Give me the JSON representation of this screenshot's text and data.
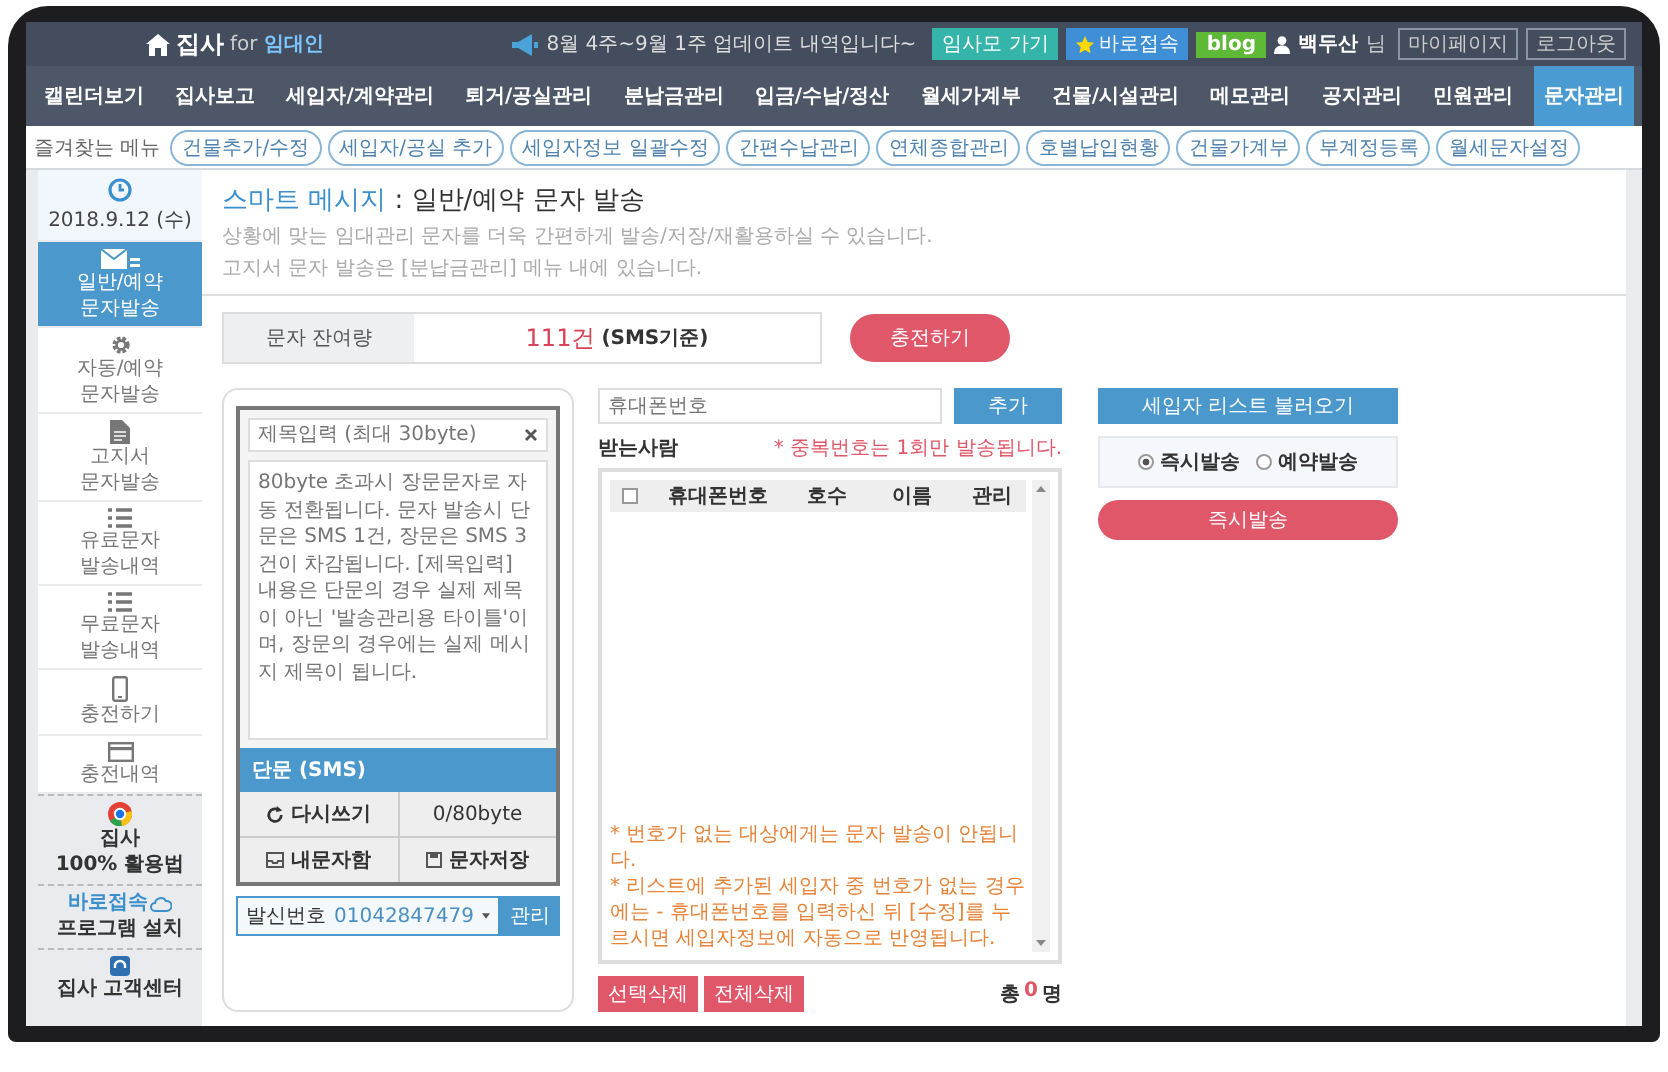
{
  "top_bar": {
    "logo": "집사",
    "logo_for": "for",
    "logo_user": "임대인",
    "notice": "8월 4주~9월 1주 업데이트 내역입니다~",
    "buttons": [
      {
        "label": "임사모 가기",
        "kind": "teal"
      },
      {
        "label": "바로접속",
        "kind": "star"
      },
      {
        "label": "blog",
        "kind": "blog"
      }
    ],
    "user": "백두산",
    "user_suffix": "님",
    "links": [
      "마이페이지",
      "로그아웃"
    ]
  },
  "nav": [
    {
      "label": "캘린더보기",
      "selected": false
    },
    {
      "label": "집사보고",
      "selected": false
    },
    {
      "label": "세입자/계약관리",
      "selected": false
    },
    {
      "label": "퇴거/공실관리",
      "selected": false
    },
    {
      "label": "분납금관리",
      "selected": false
    },
    {
      "label": "입금/수납/정산",
      "selected": false
    },
    {
      "label": "월세가계부",
      "selected": false
    },
    {
      "label": "건물/시설관리",
      "selected": false
    },
    {
      "label": "메모관리",
      "selected": false
    },
    {
      "label": "공지관리",
      "selected": false
    },
    {
      "label": "민원관리",
      "selected": false
    },
    {
      "label": "문자관리",
      "selected": true
    }
  ],
  "quick_menu": {
    "label": "즐겨찾는 메뉴",
    "items": [
      "건물추가/수정",
      "세입자/공실 추가",
      "세입자정보 일괄수정",
      "간편수납관리",
      "연체종합관리",
      "호별납입현황",
      "건물가계부",
      "부계정등록",
      "월세문자설정"
    ]
  },
  "sidebar": {
    "date": "2018.9.12 (수)",
    "items": [
      {
        "lines": [
          "일반/예약",
          "문자발송"
        ],
        "selected": true
      },
      {
        "lines": [
          "자동/예약",
          "문자발송"
        ],
        "selected": false
      },
      {
        "lines": [
          "고지서",
          "문자발송"
        ],
        "selected": false
      },
      {
        "lines": [
          "유료문자",
          "발송내역"
        ],
        "selected": false
      },
      {
        "lines": [
          "무료문자",
          "발송내역"
        ],
        "selected": false
      },
      {
        "lines": [
          "충전하기"
        ],
        "selected": false
      },
      {
        "lines": [
          "충전내역"
        ],
        "selected": false
      }
    ],
    "promos": [
      {
        "lines": [
          "집사",
          "100% 활용법"
        ]
      },
      {
        "lines": [
          "바로접속",
          "프로그램 설치"
        ]
      },
      {
        "lines": [
          "집사 고객센터"
        ]
      }
    ]
  },
  "page": {
    "title_highlight": "스마트 메시지",
    "title_rest": ": 일반/예약 문자 발송",
    "description": [
      "상황에 맞는 임대관리 문자를 더욱 간편하게 발송/저장/재활용하실 수 있습니다.",
      "고지서 문자 발송은 [분납금관리] 메뉴 내에 있습니다."
    ]
  },
  "balance": {
    "label": "문자 잔여량",
    "count": "111건",
    "unit": "(SMS기준)",
    "charge_button": "충전하기"
  },
  "composer": {
    "subject_placeholder": "제목입력 (최대 30byte)",
    "message_placeholder": "80byte 초과시 장문문자로 자동 전환됩니다. 문자 발송시 단문은 SMS 1건, 장문은 SMS 3건이 차감됩니다. [제목입력] 내용은 단문의 경우 실제 제목이 아닌 '발송관리용 타이틀'이며, 장문의 경우에는 실제 메시지 제목이 됩니다.",
    "type_label": "단문 (SMS)",
    "rewrite_button": "다시쓰기",
    "byte_count": "0/80byte",
    "inbox_button": "내문자함",
    "save_button": "문자저장",
    "sender_label": "발신번호",
    "sender_value": "01042847479",
    "manage_button": "관리"
  },
  "recipients": {
    "phone_placeholder": "휴대폰번호",
    "add_button": "추가",
    "title": "받는사람",
    "notice": "* 중복번호는 1회만 발송됩니다.",
    "select_all_checked": false,
    "columns": [
      "휴대폰번호",
      "호수",
      "이름",
      "관리"
    ],
    "notes": [
      "* 번호가 없는 대상에게는 문자 발송이 안됩니다.",
      "* 리스트에 추가된 세입자 중 번호가 없는 경우에는 - 휴대폰번호를 입력하신 뒤 [수정]를 누르시면 세입자정보에 자동으로 반영됩니다."
    ],
    "buttons": [
      "선택삭제",
      "전체삭제"
    ],
    "total_prefix": "총",
    "total": "0",
    "total_suffix": "명"
  },
  "send": {
    "load_button": "세입자 리스트 불러오기",
    "options": [
      {
        "label": "즉시발송",
        "selected": true
      },
      {
        "label": "예약발송",
        "selected": false
      }
    ],
    "send_button": "즉시발송"
  }
}
